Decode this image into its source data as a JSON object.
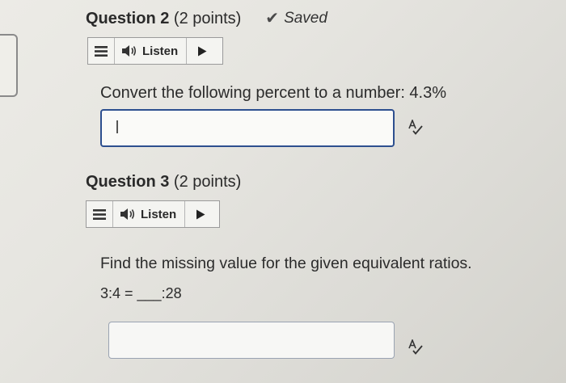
{
  "question2": {
    "title": "Question 2",
    "points": "(2 points)",
    "saved_label": "Saved",
    "listen_label": "Listen",
    "prompt": "Convert the following percent to a number:  4.3%",
    "answer_value": ""
  },
  "question3": {
    "title": "Question 3",
    "points": "(2 points)",
    "listen_label": "Listen",
    "prompt": "Find the missing value for the given equivalent ratios.",
    "equation": "3:4 = ___:28",
    "answer_value": ""
  },
  "icons": {
    "menu": "menu-icon",
    "speaker": "speaker-icon",
    "play": "play-icon",
    "check": "checkmark-icon",
    "spellcheck": "spellcheck-icon"
  },
  "colors": {
    "active_border": "#2d4f8f",
    "inactive_border": "#9aa3b2",
    "text": "#2b2b2b"
  }
}
